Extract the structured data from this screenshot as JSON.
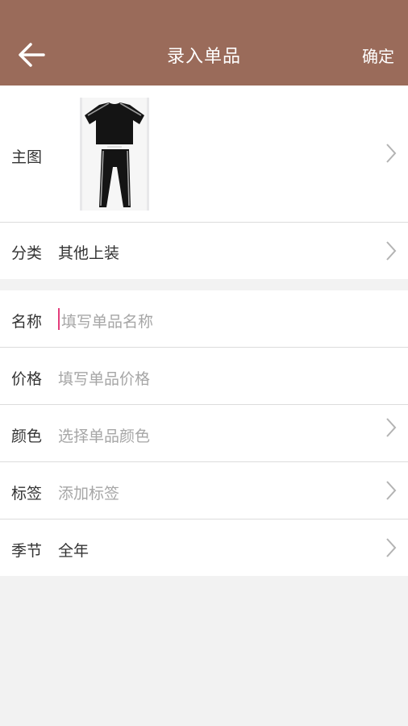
{
  "header": {
    "title": "录入单品",
    "confirm_label": "确定"
  },
  "main_image": {
    "label": "主图"
  },
  "category": {
    "label": "分类",
    "value": "其他上装"
  },
  "fields": {
    "name": {
      "label": "名称",
      "placeholder": "填写单品名称"
    },
    "price": {
      "label": "价格",
      "placeholder": "填写单品价格"
    },
    "color": {
      "label": "颜色",
      "placeholder": "选择单品颜色"
    },
    "tags": {
      "label": "标签",
      "placeholder": "添加标签"
    },
    "season": {
      "label": "季节",
      "value": "全年"
    }
  },
  "colors": {
    "header_bg": "#9a6b5a",
    "cursor": "#e33d7b",
    "placeholder": "#a6a6a6"
  }
}
